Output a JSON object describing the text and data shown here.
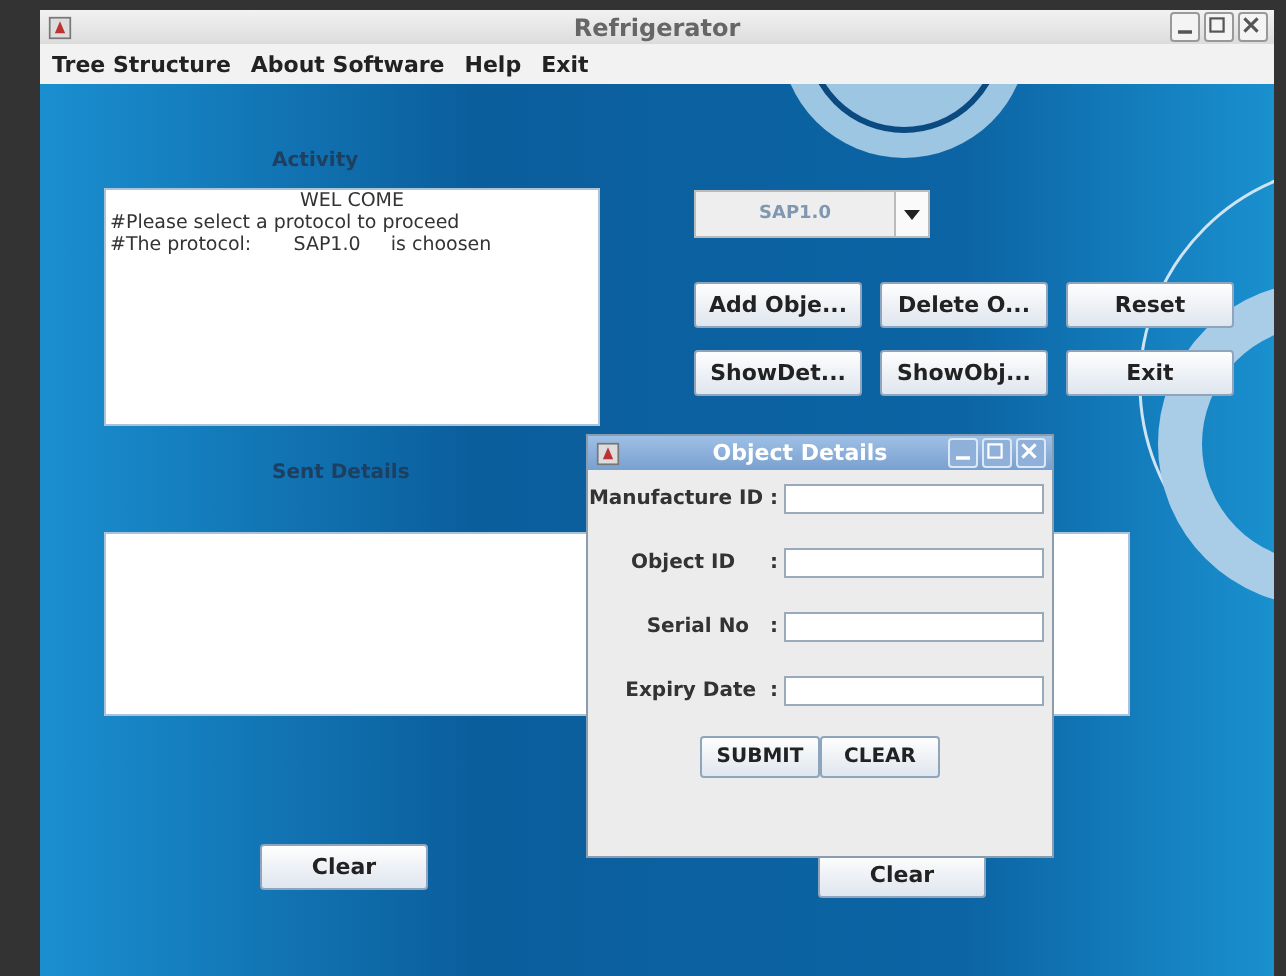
{
  "window": {
    "title": "Refrigerator"
  },
  "menu": [
    "Tree Structure",
    "About Software",
    "Help",
    "Exit"
  ],
  "activity": {
    "label": "Activity",
    "lines": [
      "WEL COME",
      "#Please select a protocol to proceed",
      "#The protocol:       SAP1.0     is choosen"
    ]
  },
  "protocol_combo": {
    "value": "SAP1.0",
    "disabled": true
  },
  "buttons": [
    "Add Obje...",
    "Delete O...",
    "Reset",
    "ShowDet...",
    "ShowObj...",
    "Exit"
  ],
  "sent_details": {
    "label": "Sent Details"
  },
  "clear_buttons": [
    "Clear",
    "Clear"
  ],
  "dialog": {
    "title": "Object Details",
    "fields": [
      {
        "label": "Manufacture ID :"
      },
      {
        "label": "Object ID     :"
      },
      {
        "label": "Serial No   :"
      },
      {
        "label": "Expiry Date  :"
      }
    ],
    "buttons": [
      "SUBMIT",
      "CLEAR"
    ]
  }
}
